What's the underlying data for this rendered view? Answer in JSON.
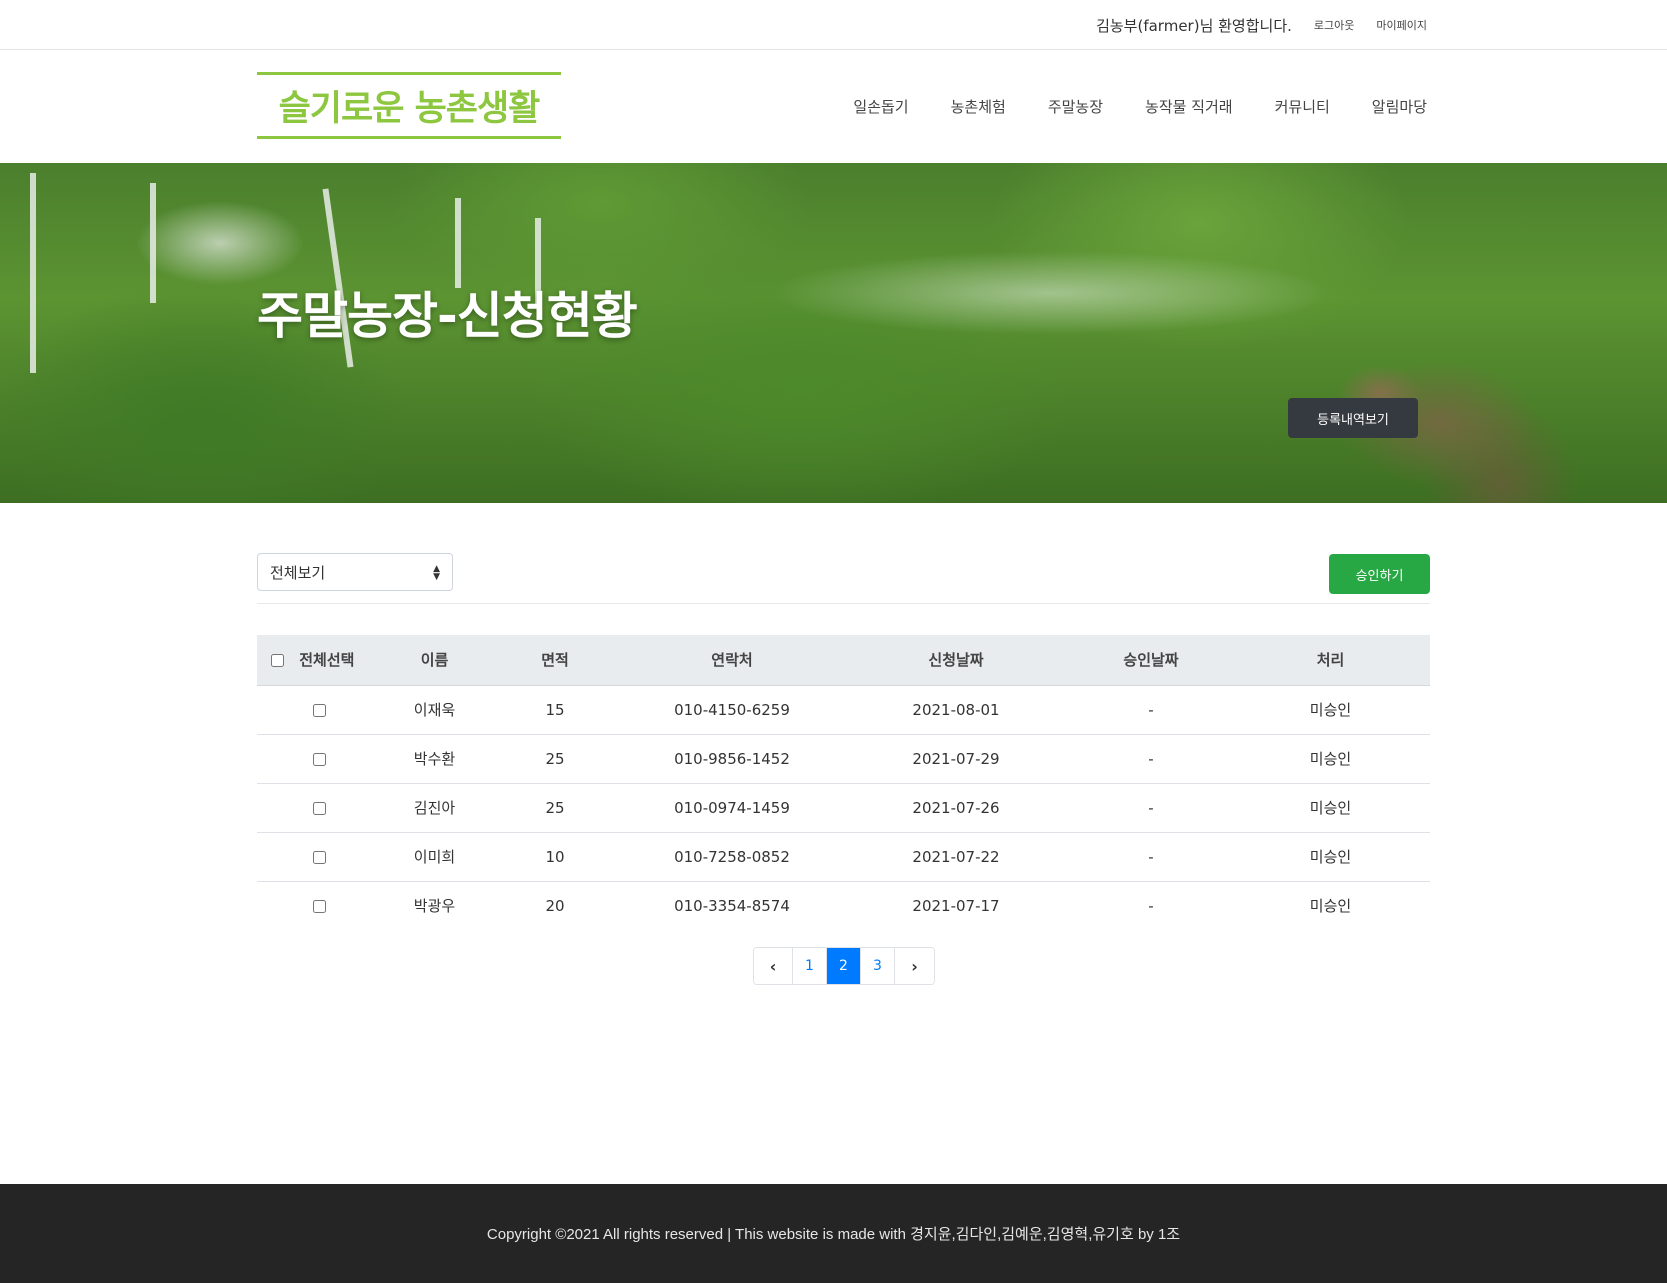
{
  "topbar": {
    "welcome": "김농부(farmer)님 환영합니다.",
    "logout": "로그아웃",
    "mypage": "마이페이지"
  },
  "header": {
    "logo": "슬기로운 농촌생활",
    "nav": [
      "일손돕기",
      "농촌체험",
      "주말농장",
      "농작물 직거래",
      "커뮤니티",
      "알림마당"
    ]
  },
  "hero": {
    "title": "주말농장-신청현황",
    "button": "등록내역보기"
  },
  "controls": {
    "filter_value": "전체보기",
    "approve_button": "승인하기"
  },
  "table": {
    "headers": [
      "전체선택",
      "이름",
      "면적",
      "연락처",
      "신청날짜",
      "승인날짜",
      "처리"
    ],
    "rows": [
      {
        "name": "이재욱",
        "area": "15",
        "phone": "010-4150-6259",
        "applied": "2021-08-01",
        "approved": "-",
        "status": "미승인"
      },
      {
        "name": "박수환",
        "area": "25",
        "phone": "010-9856-1452",
        "applied": "2021-07-29",
        "approved": "-",
        "status": "미승인"
      },
      {
        "name": "김진아",
        "area": "25",
        "phone": "010-0974-1459",
        "applied": "2021-07-26",
        "approved": "-",
        "status": "미승인"
      },
      {
        "name": "이미희",
        "area": "10",
        "phone": "010-7258-0852",
        "applied": "2021-07-22",
        "approved": "-",
        "status": "미승인"
      },
      {
        "name": "박광우",
        "area": "20",
        "phone": "010-3354-8574",
        "applied": "2021-07-17",
        "approved": "-",
        "status": "미승인"
      }
    ]
  },
  "pagination": {
    "prev_icon": "‹",
    "pages": [
      "1",
      "2",
      "3"
    ],
    "active_page": "2",
    "next_icon": "›"
  },
  "footer": {
    "text": "Copyright ©2021 All rights reserved | This website is made with 경지윤,김다인,김예운,김영혁,유기호 by 1조"
  },
  "colors": {
    "brand": "#8dc63f",
    "approve": "#28a745",
    "primary": "#007bff",
    "dark_button": "#343a40",
    "footer_bg": "#252525"
  }
}
